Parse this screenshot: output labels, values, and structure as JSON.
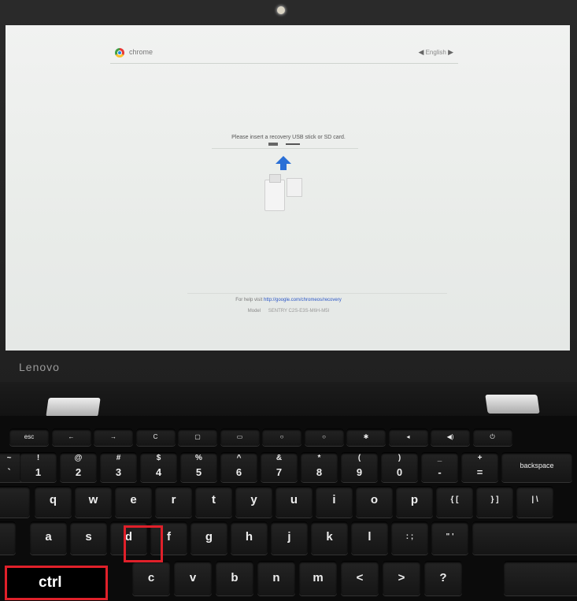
{
  "laptop": {
    "brand": "Lenovo"
  },
  "screen": {
    "chrome_label": "chrome",
    "language": "English",
    "message": "Please insert a recovery USB stick or SD card.",
    "help_prefix": "For help visit",
    "help_link": "http://google.com/chromeos/recovery",
    "model_label": "Model",
    "model_value": "SENTRY C2S-E3S-M6H-M5I"
  },
  "keyboard": {
    "fn_row": [
      "esc",
      "←",
      "→",
      "C",
      "▢",
      "▭",
      "○",
      "○",
      "✱",
      "◂",
      "◀)",
      "⏻"
    ],
    "num_row": [
      {
        "s": "~",
        "n": "`"
      },
      {
        "s": "!",
        "n": "1"
      },
      {
        "s": "@",
        "n": "2"
      },
      {
        "s": "#",
        "n": "3"
      },
      {
        "s": "$",
        "n": "4"
      },
      {
        "s": "%",
        "n": "5"
      },
      {
        "s": "^",
        "n": "6"
      },
      {
        "s": "&",
        "n": "7"
      },
      {
        "s": "*",
        "n": "8"
      },
      {
        "s": "(",
        "n": "9"
      },
      {
        "s": ")",
        "n": "0"
      },
      {
        "s": "_",
        "n": "-"
      },
      {
        "s": "+",
        "n": "="
      },
      {
        "s": "",
        "n": "backspace"
      }
    ],
    "row_q": [
      "q",
      "w",
      "e",
      "r",
      "t",
      "y",
      "u",
      "i",
      "o",
      "p",
      "{ [",
      "} ]",
      "| \\"
    ],
    "row_a": [
      "a",
      "s",
      "d",
      "f",
      "g",
      "h",
      "j",
      "k",
      "l",
      ": ;",
      "\" '"
    ],
    "row_z": [
      "c",
      "v",
      "b",
      "n",
      "m",
      "<",
      ">",
      "?"
    ]
  },
  "annotations": {
    "highlighted_key": "d",
    "ctrl_label": "ctrl",
    "highlight_color": "#e0202a"
  }
}
